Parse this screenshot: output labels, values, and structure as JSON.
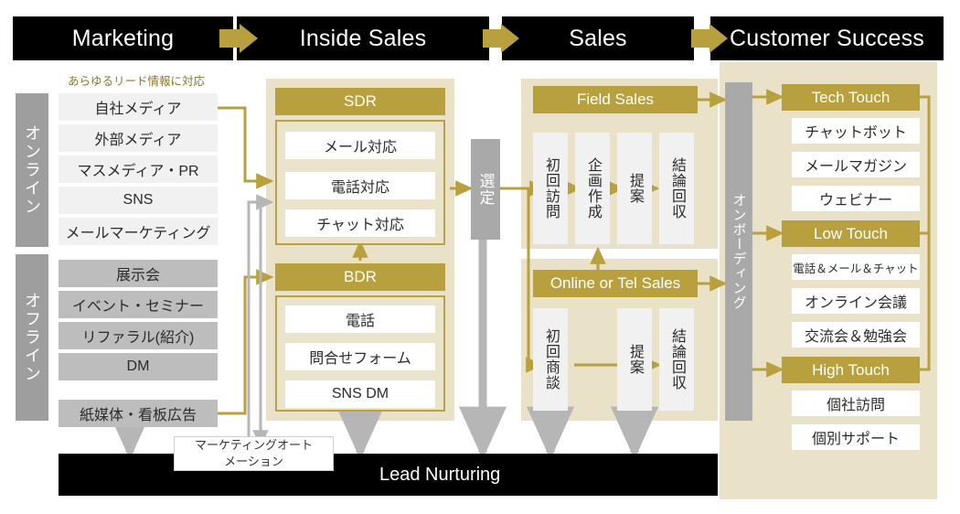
{
  "phases": [
    {
      "label": "Marketing"
    },
    {
      "label": "Inside Sales"
    },
    {
      "label": "Sales"
    },
    {
      "label": "Customer Success"
    }
  ],
  "marketing": {
    "caption": "あらゆるリード情報に対応",
    "online_label": "オンライン",
    "offline_label": "オフライン",
    "online_items": [
      "自社メディア",
      "外部メディア",
      "マスメディア・PR",
      "SNS",
      "メールマーケティング"
    ],
    "offline_items": [
      "展示会",
      "イベント・セミナー",
      "リファラル(紹介)",
      "DM",
      "紙媒体・看板広告"
    ]
  },
  "inside_sales": {
    "sdr": {
      "title": "SDR",
      "items": [
        "メール対応",
        "電話対応",
        "チャット対応"
      ]
    },
    "bdr": {
      "title": "BDR",
      "items": [
        "電話",
        "問合せフォーム",
        "SNS DM"
      ]
    }
  },
  "sales": {
    "selection": "選定",
    "field_sales": {
      "title": "Field Sales",
      "steps": [
        "初回訪問",
        "企画作成",
        "提案",
        "結論回収"
      ]
    },
    "online_tel_sales": {
      "title": "Online or Tel Sales",
      "steps": [
        "初回商談",
        "提案",
        "結論回収"
      ]
    }
  },
  "customer_success": {
    "onboarding": "オンボーディング",
    "groups": [
      {
        "title": "Tech Touch",
        "items": [
          "チャットボット",
          "メールマガジン",
          "ウェビナー"
        ]
      },
      {
        "title": "Low Touch",
        "items": [
          "電話＆メール＆チャット",
          "オンライン会議",
          "交流会＆勉強会"
        ]
      },
      {
        "title": "High Touch",
        "items": [
          "個社訪問",
          "個別サポート"
        ]
      }
    ]
  },
  "bottom": {
    "marketing_automation": "マーケティングオート\nメーション",
    "lead_nurturing": "Lead Nurturing"
  },
  "colors": {
    "gold": "#b8a03e",
    "panel": "#e9e2c8",
    "gray": "#9e9e9e",
    "black": "#000000",
    "arrow_gray": "#b6b6b6"
  }
}
